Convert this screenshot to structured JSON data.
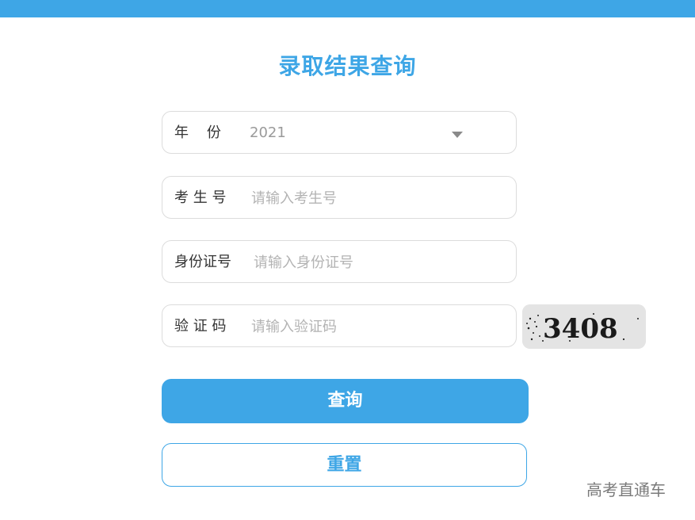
{
  "title": "录取结果查询",
  "form": {
    "year": {
      "label": "年    份",
      "value": "2021"
    },
    "exam_no": {
      "label": "考 生 号",
      "placeholder": "请输入考生号"
    },
    "id_no": {
      "label": "身份证号",
      "placeholder": "请输入身份证号"
    },
    "captcha": {
      "label": "验 证 码",
      "placeholder": "请输入验证码",
      "image_text": "3408"
    }
  },
  "buttons": {
    "query": "查询",
    "reset": "重置"
  },
  "watermark": "高考直通车",
  "colors": {
    "accent": "#3ea6e6",
    "border": "#dcdcdc",
    "placeholder": "#b3b3b3"
  }
}
